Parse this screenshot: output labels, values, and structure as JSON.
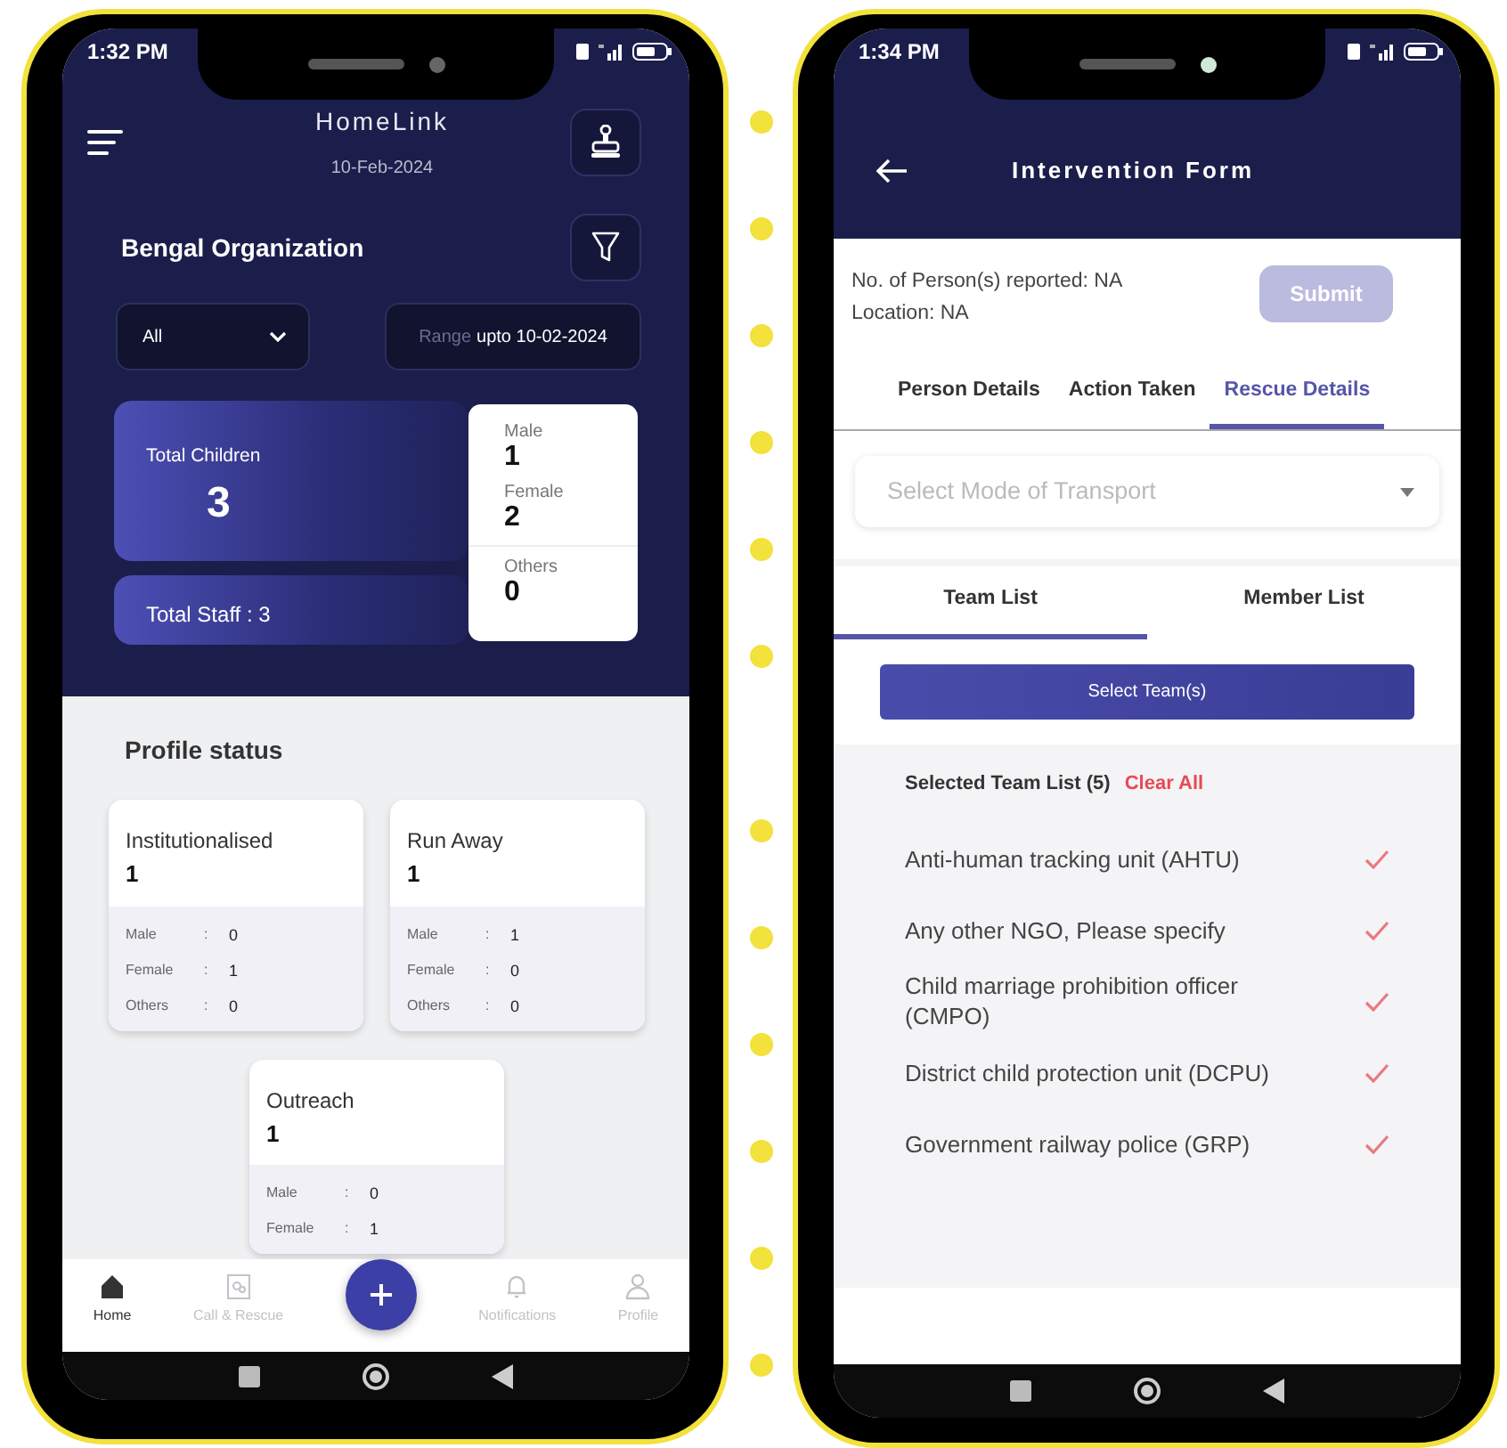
{
  "home_screen": {
    "status_time": "1:32 PM",
    "app_title": "HomeLink",
    "date": "10-Feb-2024",
    "organization": "Bengal Organization",
    "filter_select": "All",
    "range_label": "Range",
    "range_value": "upto 10-02-2024",
    "total_children": {
      "label": "Total Children",
      "value": "3"
    },
    "total_staff": "Total Staff : 3",
    "gender_counts": [
      {
        "label": "Male",
        "value": "1"
      },
      {
        "label": "Female",
        "value": "2"
      },
      {
        "label": "Others",
        "value": "0"
      }
    ],
    "profile_status_title": "Profile status",
    "status_cards": [
      {
        "title": "Institutionalised",
        "count": "1",
        "rows": [
          {
            "label": "Male",
            "separator": ":",
            "value": "0"
          },
          {
            "label": "Female",
            "separator": ":",
            "value": "1"
          },
          {
            "label": "Others",
            "separator": ":",
            "value": "0"
          }
        ]
      },
      {
        "title": "Run Away",
        "count": "1",
        "rows": [
          {
            "label": "Male",
            "separator": ":",
            "value": "1"
          },
          {
            "label": "Female",
            "separator": ":",
            "value": "0"
          },
          {
            "label": "Others",
            "separator": ":",
            "value": "0"
          }
        ]
      },
      {
        "title": "Outreach",
        "count": "1",
        "rows": [
          {
            "label": "Male",
            "separator": ":",
            "value": "0"
          },
          {
            "label": "Female",
            "separator": ":",
            "value": "1"
          }
        ]
      }
    ],
    "nav_items": [
      {
        "kind": "tab",
        "label": "Home",
        "selected": true
      },
      {
        "kind": "tab",
        "label": "Call & Rescue",
        "selected": false
      },
      {
        "kind": "fab"
      },
      {
        "kind": "tab",
        "label": "Notifications",
        "selected": false
      },
      {
        "kind": "tab",
        "label": "Profile",
        "selected": false
      }
    ]
  },
  "intervention_screen": {
    "status_time": "1:34 PM",
    "title": "Intervention Form",
    "persons_reported": "No. of Person(s) reported: NA",
    "location": "Location: NA",
    "submit_button": {
      "label": "Submit",
      "disabled": true
    },
    "tabs": [
      {
        "label": "Person Details",
        "selected": false
      },
      {
        "label": "Action Taken",
        "selected": false
      },
      {
        "label": "Rescue Details",
        "selected": true
      }
    ],
    "transport_select": {
      "placeholder": "Select Mode of Transport"
    },
    "list_tabs": [
      {
        "label": "Team List",
        "selected": true
      },
      {
        "label": "Member List",
        "selected": false
      }
    ],
    "select_teams_button": "Select Team(s)",
    "selected_heading": "Selected Team List (5)",
    "clear_all": "Clear All",
    "teams": [
      {
        "label": "Anti-human tracking unit (AHTU)",
        "checked": true
      },
      {
        "label": "Any other NGO, Please specify",
        "checked": true
      },
      {
        "label": "Child marriage prohibition officer (CMPO)",
        "checked": true
      },
      {
        "label": "District child protection unit (DCPU)",
        "checked": true
      },
      {
        "label": "Government railway police (GRP)",
        "checked": true
      }
    ]
  }
}
